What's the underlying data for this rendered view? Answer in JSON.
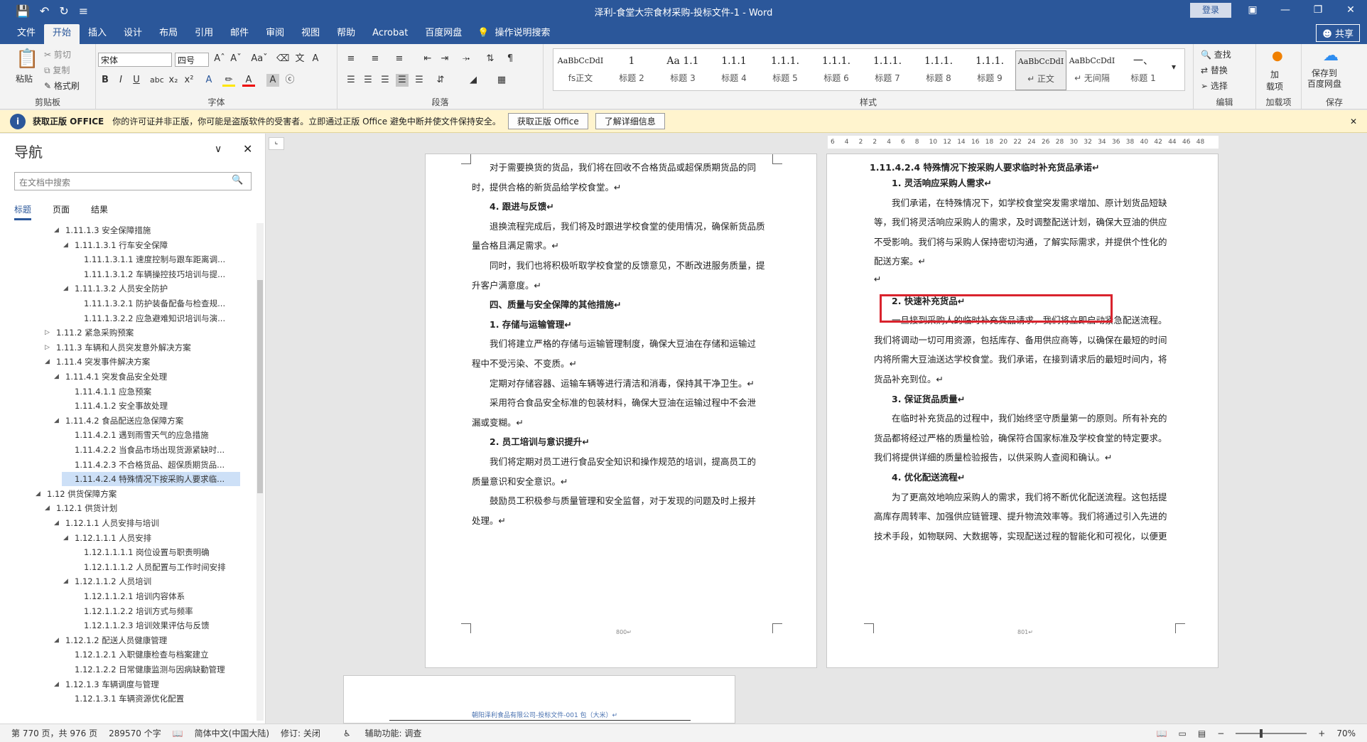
{
  "titlebar": {
    "title": "泽利-食堂大宗食材采购-投标文件-1  -  Word",
    "login": "登录"
  },
  "tabs": [
    "文件",
    "开始",
    "插入",
    "设计",
    "布局",
    "引用",
    "邮件",
    "审阅",
    "视图",
    "帮助",
    "Acrobat",
    "百度网盘"
  ],
  "tell_me": "操作说明搜索",
  "share": "共享",
  "ribbon": {
    "clipboard": {
      "paste": "粘贴",
      "cut": "剪切",
      "copy": "复制",
      "format_painter": "格式刷",
      "label": "剪贴板"
    },
    "font": {
      "name": "宋体",
      "size": "四号",
      "label": "字体"
    },
    "paragraph": {
      "label": "段落"
    },
    "styles": {
      "label": "样式",
      "items": [
        {
          "preview": "AaBbCcDdI",
          "name": "fs正文"
        },
        {
          "preview": "1",
          "name": "标题 2"
        },
        {
          "preview": "Aa 1.1",
          "name": "标题 3"
        },
        {
          "preview": "1.1.1",
          "name": "标题 4"
        },
        {
          "preview": "1.1.1.",
          "name": "标题 5"
        },
        {
          "preview": "1.1.1.",
          "name": "标题 6"
        },
        {
          "preview": "1.1.1.",
          "name": "标题 7"
        },
        {
          "preview": "1.1.1.",
          "name": "标题 8"
        },
        {
          "preview": "1.1.1.",
          "name": "标题 9"
        },
        {
          "preview": "AaBbCcDdI",
          "name": "↵ 正文"
        },
        {
          "preview": "AaBbCcDdI",
          "name": "↵ 无间隔"
        },
        {
          "preview": "一、",
          "name": "标题 1"
        }
      ]
    },
    "editing": {
      "find": "查找",
      "replace": "替换",
      "select": "选择",
      "label": "编辑"
    },
    "addins": {
      "btn": "加\n载项",
      "label": "加载项"
    },
    "save": {
      "btn": "保存到\n百度网盘",
      "label": "保存"
    }
  },
  "message": {
    "title": "获取正版 OFFICE",
    "text": "你的许可证并非正版，你可能是盗版软件的受害者。立即通过正版 Office 避免中断并使文件保持安全。",
    "btn1": "获取正版 Office",
    "btn2": "了解详细信息"
  },
  "nav": {
    "title": "导航",
    "search_placeholder": "在文档中搜索",
    "tabs": [
      "标题",
      "页面",
      "结果"
    ],
    "items": [
      {
        "t": "1.11.1.3 安全保障措施",
        "l": 3
      },
      {
        "t": "1.11.1.3.1 行车安全保障",
        "l": 4
      },
      {
        "t": "1.11.1.3.1.1 速度控制与跟车距离调...",
        "l": 5
      },
      {
        "t": "1.11.1.3.1.2 车辆操控技巧培训与提...",
        "l": 5
      },
      {
        "t": "1.11.1.3.2 人员安全防护",
        "l": 4
      },
      {
        "t": "1.11.1.3.2.1 防护装备配备与检查规...",
        "l": 5
      },
      {
        "t": "1.11.1.3.2.2 应急避难知识培训与演...",
        "l": 5
      },
      {
        "t": "1.11.2 紧急采购预案",
        "l": 2
      },
      {
        "t": "1.11.3 车辆和人员突发意外解决方案",
        "l": 2
      },
      {
        "t": "1.11.4 突发事件解决方案",
        "l": 2
      },
      {
        "t": "1.11.4.1 突发食品安全处理",
        "l": 3
      },
      {
        "t": "1.11.4.1.1 应急预案",
        "l": 4
      },
      {
        "t": "1.11.4.1.2 安全事故处理",
        "l": 4
      },
      {
        "t": "1.11.4.2 食品配送应急保障方案",
        "l": 3
      },
      {
        "t": "1.11.4.2.1 遇到雨雪天气的应急措施",
        "l": 4
      },
      {
        "t": "1.11.4.2.2 当食品市场出现货源紧缺时...",
        "l": 4
      },
      {
        "t": "1.11.4.2.3 不合格货品、超保质期货品...",
        "l": 4
      },
      {
        "t": "1.11.4.2.4 特殊情况下按采购人要求临...",
        "l": 4
      },
      {
        "t": "1.12 供货保障方案",
        "l": 1
      },
      {
        "t": "1.12.1 供货计划",
        "l": 2
      },
      {
        "t": "1.12.1.1 人员安排与培训",
        "l": 3
      },
      {
        "t": "1.12.1.1.1 人员安排",
        "l": 4
      },
      {
        "t": "1.12.1.1.1.1 岗位设置与职责明确",
        "l": 5
      },
      {
        "t": "1.12.1.1.1.2 人员配置与工作时间安排",
        "l": 5
      },
      {
        "t": "1.12.1.1.2 人员培训",
        "l": 4
      },
      {
        "t": "1.12.1.1.2.1 培训内容体系",
        "l": 5
      },
      {
        "t": "1.12.1.1.2.2 培训方式与频率",
        "l": 5
      },
      {
        "t": "1.12.1.1.2.3 培训效果评估与反馈",
        "l": 5
      },
      {
        "t": "1.12.1.2 配送人员健康管理",
        "l": 3
      },
      {
        "t": "1.12.1.2.1 入职健康检查与档案建立",
        "l": 4
      },
      {
        "t": "1.12.1.2.2 日常健康监测与因病缺勤管理",
        "l": 4
      },
      {
        "t": "1.12.1.3 车辆调度与管理",
        "l": 3
      },
      {
        "t": "1.12.1.3.1 车辆资源优化配置",
        "l": 4
      }
    ]
  },
  "page_left": {
    "lines": [
      {
        "t": "对于需要换货的货品，我们将在回收不合格货品或超保质期货品的同",
        "b": false,
        "i": true
      },
      {
        "t": "时，提供合格的新货品给学校食堂。↵",
        "b": false,
        "i": false
      },
      {
        "t": "4. 跟进与反馈↵",
        "b": true,
        "i": true
      },
      {
        "t": "退换流程完成后，我们将及时跟进学校食堂的使用情况，确保新货品质",
        "b": false,
        "i": true
      },
      {
        "t": "量合格且满足需求。↵",
        "b": false,
        "i": false
      },
      {
        "t": "同时，我们也将积极听取学校食堂的反馈意见，不断改进服务质量，提",
        "b": false,
        "i": true
      },
      {
        "t": "升客户满意度。↵",
        "b": false,
        "i": false
      },
      {
        "t": "四、质量与安全保障的其他措施↵",
        "b": true,
        "i": true
      },
      {
        "t": "1. 存储与运输管理↵",
        "b": true,
        "i": true
      },
      {
        "t": "我们将建立严格的存储与运输管理制度，确保大豆油在存储和运输过",
        "b": false,
        "i": true
      },
      {
        "t": "程中不受污染、不变质。↵",
        "b": false,
        "i": false
      },
      {
        "t": "定期对存储容器、运输车辆等进行清洁和消毒，保持其干净卫生。↵",
        "b": false,
        "i": true
      },
      {
        "t": "采用符合食品安全标准的包装材料，确保大豆油在运输过程中不会泄",
        "b": false,
        "i": true
      },
      {
        "t": "漏或变糊。↵",
        "b": false,
        "i": false
      },
      {
        "t": "2. 员工培训与意识提升↵",
        "b": true,
        "i": true
      },
      {
        "t": "我们将定期对员工进行食品安全知识和操作规范的培训，提高员工的",
        "b": false,
        "i": true
      },
      {
        "t": "质量意识和安全意识。↵",
        "b": false,
        "i": false
      },
      {
        "t": "鼓励员工积极参与质量管理和安全监督，对于发现的问题及时上报并",
        "b": false,
        "i": true
      },
      {
        "t": "处理。↵",
        "b": false,
        "i": false
      }
    ],
    "page_no": "800↵"
  },
  "page_right": {
    "lines": [
      {
        "t": "1.11.4.2.4  特殊情况下按采购人要求临时补充货品承诺↵",
        "b": true,
        "i": false
      },
      {
        "t": "1. 灵活响应采购人需求↵",
        "b": true,
        "i": true
      },
      {
        "t": "我们承诺，在特殊情况下，如学校食堂突发需求增加、原计划货品短缺",
        "b": false,
        "i": true
      },
      {
        "t": "等，我们将灵活响应采购人的需求，及时调整配送计划，确保大豆油的供应",
        "b": false,
        "i": false
      },
      {
        "t": "不受影响。我们将与采购人保持密切沟通，了解实际需求，并提供个性化的",
        "b": false,
        "i": false
      },
      {
        "t": "配送方案。↵",
        "b": false,
        "i": false
      },
      {
        "t": "↵",
        "b": false,
        "i": false
      },
      {
        "t": "2. 快速补充货品↵",
        "b": true,
        "i": true
      },
      {
        "t": "一旦接到采购人的临时补充货品请求，我们将立即启动紧急配送流程。",
        "b": false,
        "i": true
      },
      {
        "t": "我们将调动一切可用资源，包括库存、备用供应商等，以确保在最短的时间",
        "b": false,
        "i": false
      },
      {
        "t": "内将所需大豆油送达学校食堂。我们承诺，在接到请求后的最短时间内，将",
        "b": false,
        "i": false
      },
      {
        "t": "货品补充到位。↵",
        "b": false,
        "i": false
      },
      {
        "t": "3. 保证货品质量↵",
        "b": true,
        "i": true
      },
      {
        "t": "在临时补充货品的过程中，我们始终坚守质量第一的原则。所有补充的",
        "b": false,
        "i": true
      },
      {
        "t": "货品都将经过严格的质量检验，确保符合国家标准及学校食堂的特定要求。",
        "b": false,
        "i": false
      },
      {
        "t": "我们将提供详细的质量检验报告，以供采购人查阅和确认。↵",
        "b": false,
        "i": false
      },
      {
        "t": "4. 优化配送流程↵",
        "b": true,
        "i": true
      },
      {
        "t": "为了更高效地响应采购人的需求，我们将不断优化配送流程。这包括提",
        "b": false,
        "i": true
      },
      {
        "t": "高库存周转率、加强供应链管理、提升物流效率等。我们将通过引入先进的",
        "b": false,
        "i": false
      },
      {
        "t": "技术手段，如物联网、大数据等，实现配送过程的智能化和可视化，以便更",
        "b": false,
        "i": false
      }
    ],
    "page_no": "801↵"
  },
  "page_bottom": {
    "header": "朝阳泽利食品有限公司-投标文件-001 包（大米）↵"
  },
  "ruler": [
    "6",
    "4",
    "2",
    "2",
    "4",
    "6",
    "8",
    "10",
    "12",
    "14",
    "16",
    "18",
    "20",
    "22",
    "24",
    "26",
    "28",
    "30",
    "32",
    "34",
    "36",
    "38",
    "40",
    "42",
    "44",
    "46",
    "48"
  ],
  "status": {
    "page": "第 770 页，共 976 页",
    "words": "289570 个字",
    "lang": "简体中文(中国大陆)",
    "track": "修订: 关闭",
    "access": "辅助功能: 调查",
    "zoom": "70%"
  }
}
